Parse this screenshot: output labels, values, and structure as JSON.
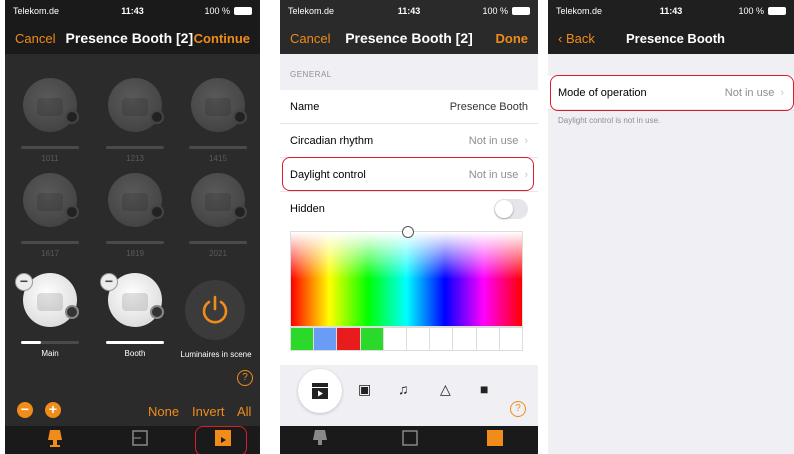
{
  "status": {
    "carrier": "Telekom.de",
    "time": "11:43",
    "battery": "100 %"
  },
  "screen1": {
    "nav": {
      "cancel": "Cancel",
      "title": "Presence Booth [2]",
      "continue": "Continue"
    },
    "tiles": [
      {
        "label": "1011",
        "on": false,
        "level": 0
      },
      {
        "label": "1213",
        "on": false,
        "level": 0
      },
      {
        "label": "1415",
        "on": false,
        "level": 0
      },
      {
        "label": "1617",
        "on": false,
        "level": 0
      },
      {
        "label": "1819",
        "on": false,
        "level": 0
      },
      {
        "label": "2021",
        "on": false,
        "level": 0
      },
      {
        "label": "Main",
        "on": true,
        "level": 0.35
      },
      {
        "label": "Booth",
        "on": true,
        "level": 1.0
      }
    ],
    "power_tile_label": "Luminaires in scene",
    "help": "?",
    "minus": "−",
    "plus": "+",
    "select": {
      "none": "None",
      "invert": "Invert",
      "all": "All"
    }
  },
  "screen2": {
    "nav": {
      "cancel": "Cancel",
      "title": "Presence Booth [2]",
      "done": "Done"
    },
    "section": "GENERAL",
    "rows": {
      "name": {
        "key": "Name",
        "value": "Presence Booth"
      },
      "circadian": {
        "key": "Circadian rhythm",
        "value": "Not in use"
      },
      "daylight": {
        "key": "Daylight control",
        "value": "Not in use"
      },
      "hidden": {
        "key": "Hidden"
      }
    },
    "swatch_colors": [
      "#2bd92b",
      "#6b9cf5",
      "#e81c1c",
      "#2bd92b",
      "#ffffff",
      "#ffffff",
      "#ffffff",
      "#ffffff",
      "#ffffff",
      "#ffffff"
    ],
    "help": "?"
  },
  "screen3": {
    "nav": {
      "back": "Back",
      "title": "Presence Booth"
    },
    "row": {
      "key": "Mode of operation",
      "value": "Not in use"
    },
    "footnote": "Daylight control is not in use."
  },
  "colors": {
    "accent": "#f08c1a",
    "highlight": "#d61f2b"
  }
}
